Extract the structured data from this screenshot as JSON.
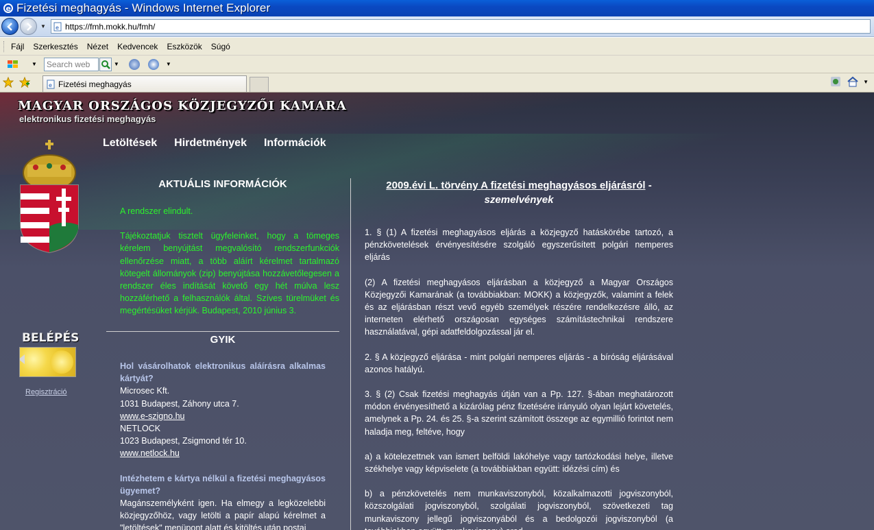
{
  "window": {
    "title": "Fizetési meghagyás - Windows Internet Explorer"
  },
  "address": {
    "url": "https://fmh.mokk.hu/fmh/"
  },
  "menu": [
    "Fájl",
    "Szerkesztés",
    "Nézet",
    "Kedvencek",
    "Eszközök",
    "Súgó"
  ],
  "search": {
    "placeholder": "Search web"
  },
  "tab": {
    "label": "Fizetési meghagyás"
  },
  "site": {
    "title": "MAGYAR ORSZÁGOS KÖZJEGYZŐI KAMARA",
    "subtitle": "elektronikus fizetési meghagyás",
    "nav": [
      "Letöltések",
      "Hirdetmények",
      "Információk"
    ]
  },
  "left": {
    "login_title": "BELÉPÉS",
    "register_link": "Regisztráció"
  },
  "news": {
    "title": "AKTUÁLIS INFORMÁCIÓK",
    "p1": "A rendszer elindult.",
    "p2": "Tájékoztatjuk tisztelt ügyfeleinket, hogy a tömeges kérelem benyújtást megvalósító rendszerfunkciók ellenőrzése miatt, a több aláírt kérelmet tartalmazó kötegelt állományok (zip) benyújtása hozzávetőlegesen a rendszer éles indítását követő egy hét múlva lesz hozzáférhető a felhasználók által. Szíves türelmüket és megértésüket kérjük. Budapest, 2010 június 3."
  },
  "faq": {
    "title": "GYIK",
    "q1": "Hol vásárolhatok elektronikus aláírásra alkalmas kártyát?",
    "a1_l1": "Microsec Kft.",
    "a1_l2": "1031 Budapest, Záhony utca 7.",
    "a1_link1": "www.e-szigno.hu",
    "a1_l3": "NETLOCK",
    "a1_l4": "1023 Budapest, Zsigmond tér 10.",
    "a1_link2": "www.netlock.hu",
    "q2": "Intézhetem e kártya nélkül a fizetési meghagyásos ügyemet?",
    "a2": "Magánszemélyként igen. Ha elmegy a legközelebbi közjegyzőhöz, vagy letölti a papír alapú kérelmet a \"letöltések\" menüpont alatt és kitöltés után postai"
  },
  "law": {
    "title1": "2009.évi L. törvény A fizetési meghagyásos eljárásról",
    "dash": " -",
    "title2": "szemelvények",
    "p1": "1. § (1) A fizetési meghagyásos eljárás a közjegyző hatáskörébe tartozó, a pénzkövetelések érvényesítésére szolgáló egyszerűsített polgári nemperes eljárás",
    "p2": "(2) A fizetési meghagyásos eljárásban a közjegyző a Magyar Országos Közjegyzői Kamarának (a továbbiakban: MOKK) a közjegyzők, valamint a felek és az eljárásban részt vevő egyéb személyek részére rendelkezésre álló, az interneten elérhető országosan egységes számítástechnikai rendszere használatával, gépi adatfeldolgozással jár el.",
    "p3": "2. § A közjegyző eljárása - mint polgári nemperes eljárás - a bíróság eljárásával azonos hatályú.",
    "p4": "3. § (2) Csak fizetési meghagyás útján van a Pp. 127. §-ában meghatározott módon érvényesíthető a kizárólag pénz fizetésére irányuló olyan lejárt követelés, amelynek a Pp. 24. és 25. §-a szerint számított összege az egymillió forintot nem haladja meg, feltéve, hogy",
    "p5": "a) a kötelezettnek van ismert belföldi lakóhelye vagy tartózkodási helye, illetve székhelye vagy képviselete (a továbbiakban együtt: idézési cím) és",
    "p6": "b) a pénzkövetelés nem munkaviszonyból, közalkalmazotti jogviszonyból, közszolgálati jogviszonyból, szolgálati jogviszonyból, szövetkezeti tag munkaviszony jellegű jogviszonyából és a bedolgozói jogviszonyból (a továbbiakban együtt: munkaviszony) ered."
  },
  "colors": {
    "titlebar": "#0a49c2",
    "news_green": "#2cf42c",
    "faq_question": "#b8c6ea",
    "page_bg": "#4b5068"
  }
}
